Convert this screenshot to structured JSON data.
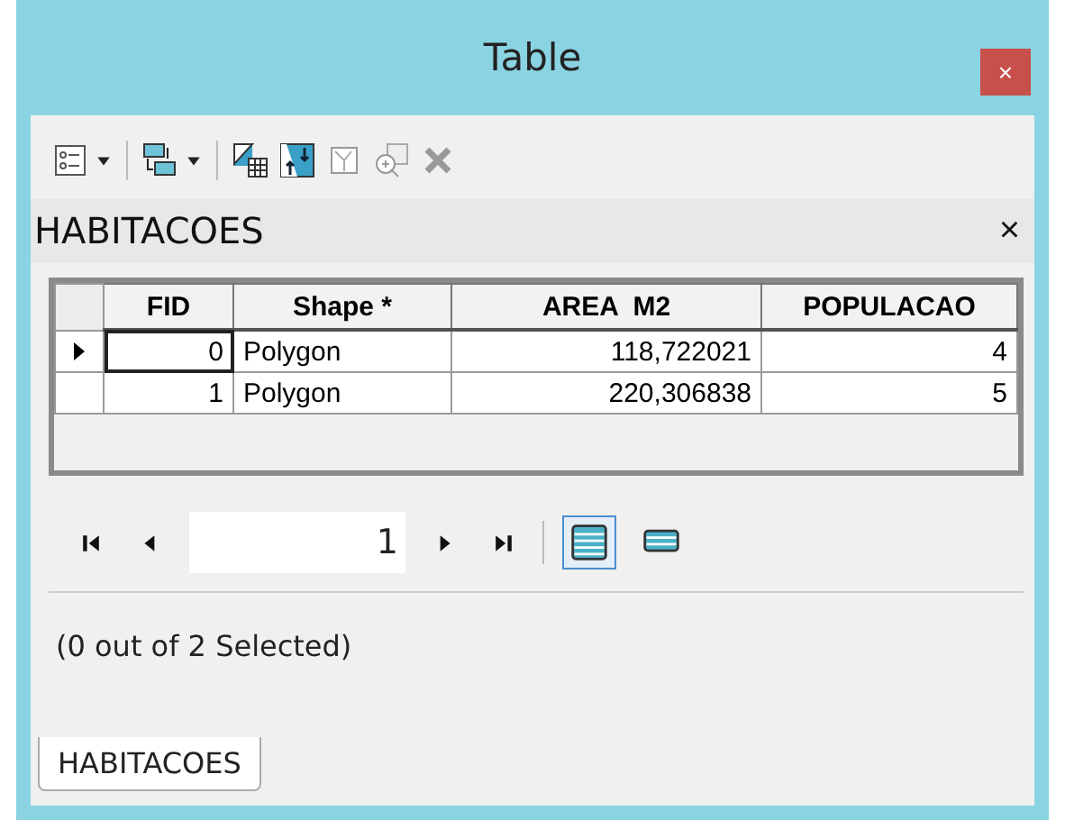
{
  "window": {
    "title": "Table",
    "close": "×"
  },
  "panel": {
    "title": "HABITACOES",
    "close": "×"
  },
  "table": {
    "columns": [
      "FID",
      "Shape *",
      "AREA  M2",
      "POPULACAO"
    ],
    "rows": [
      {
        "current": true,
        "cells": [
          "0",
          "Polygon",
          "118,722021",
          "4"
        ]
      },
      {
        "current": false,
        "cells": [
          "1",
          "Polygon",
          "220,306838",
          "5"
        ]
      }
    ]
  },
  "navigator": {
    "record": "1",
    "views": [
      {
        "kind": "all",
        "selected": true
      },
      {
        "kind": "selected",
        "selected": false
      }
    ]
  },
  "status": "(0 out of 2 Selected)",
  "tabs": [
    {
      "label": "HABITACOES",
      "selected": true
    }
  ]
}
